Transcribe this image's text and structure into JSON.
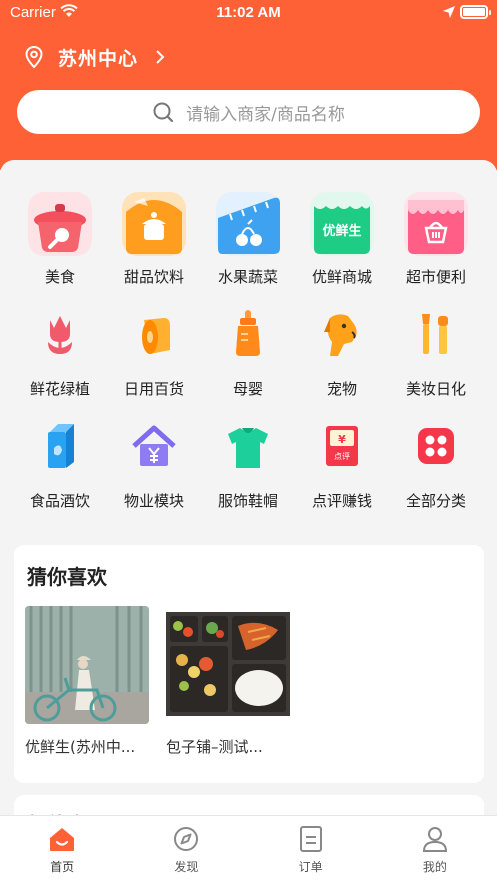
{
  "status_bar": {
    "carrier": "Carrier",
    "time": "11:02 AM"
  },
  "location": {
    "name": "苏州中心"
  },
  "search": {
    "placeholder": "请输入商家/商品名称"
  },
  "categories": [
    {
      "label": "美食",
      "icon": "food-pot-icon"
    },
    {
      "label": "甜品饮料",
      "icon": "dessert-icon"
    },
    {
      "label": "水果蔬菜",
      "icon": "fruit-icon"
    },
    {
      "label": "优鲜商城",
      "icon": "youxian-store-icon",
      "badge": "优鲜生"
    },
    {
      "label": "超市便利",
      "icon": "supermarket-icon"
    },
    {
      "label": "鲜花绿植",
      "icon": "flower-icon"
    },
    {
      "label": "日用百货",
      "icon": "paper-roll-icon"
    },
    {
      "label": "母婴",
      "icon": "baby-bottle-icon"
    },
    {
      "label": "宠物",
      "icon": "dog-icon"
    },
    {
      "label": "美妆日化",
      "icon": "makeup-icon"
    },
    {
      "label": "食品酒饮",
      "icon": "milk-carton-icon"
    },
    {
      "label": "物业模块",
      "icon": "property-house-icon"
    },
    {
      "label": "服饰鞋帽",
      "icon": "tshirt-icon"
    },
    {
      "label": "点评赚钱",
      "icon": "review-envelope-icon",
      "badge": "点评",
      "symbol": "¥"
    },
    {
      "label": "全部分类",
      "icon": "all-categories-icon"
    }
  ],
  "recommend": {
    "title": "猜你喜欢",
    "items": [
      {
        "name": "优鲜生(苏州中...",
        "image": "woman-with-bicycle-photo"
      },
      {
        "name": "包子铺–测试...",
        "image": "bento-lunch-box-photo"
      }
    ]
  },
  "section2": {
    "title": "超值商品"
  },
  "tabbar": [
    {
      "label": "首页",
      "icon": "home-icon",
      "active": true
    },
    {
      "label": "发现",
      "icon": "compass-icon",
      "active": false
    },
    {
      "label": "订单",
      "icon": "order-list-icon",
      "active": false
    },
    {
      "label": "我的",
      "icon": "user-profile-icon",
      "active": false
    }
  ],
  "colors": {
    "brand": "#ff6136",
    "background": "#f4f4f4"
  }
}
